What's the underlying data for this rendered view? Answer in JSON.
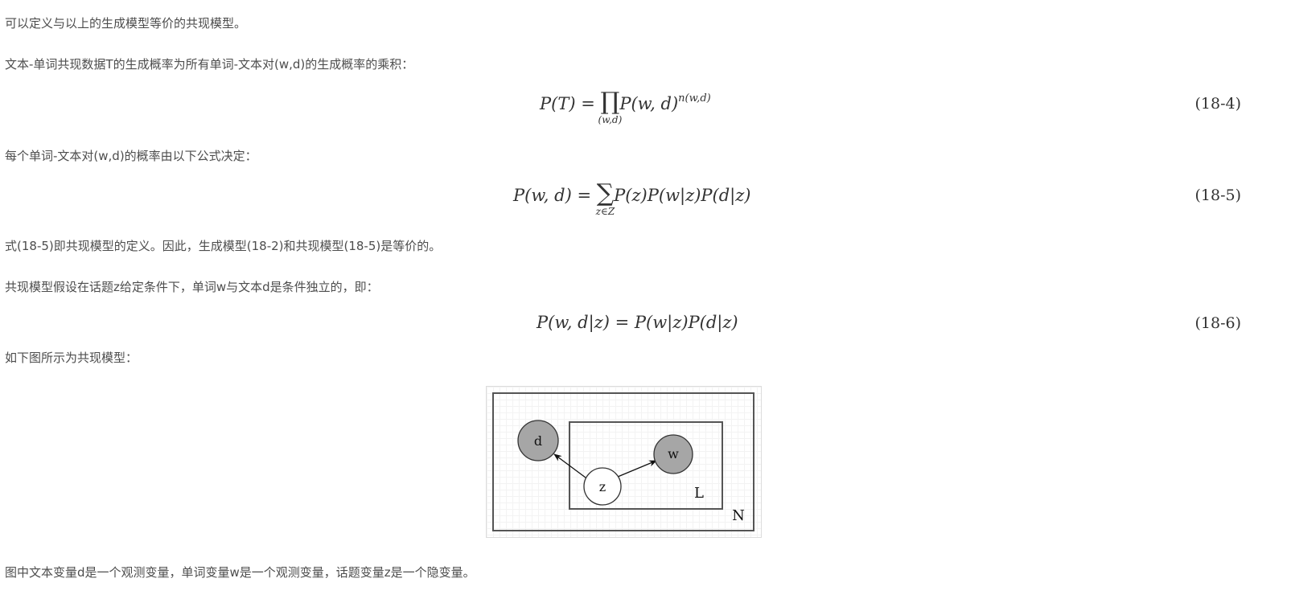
{
  "paragraphs": {
    "p1": "可以定义与以上的生成模型等价的共现模型。",
    "p2": "文本-单词共现数据T的生成概率为所有单词-文本对(w,d)的生成概率的乘积：",
    "p3": "每个单词-文本对(w,d)的概率由以下公式决定：",
    "p4": "式(18-5)即共现模型的定义。因此，生成模型(18-2)和共现模型(18-5)是等价的。",
    "p5": "共现模型假设在话题z给定条件下，单词w与文本d是条件独立的，即：",
    "p6": "如下图所示为共现模型：",
    "p7": "图中文本变量d是一个观测变量，单词变量w是一个观测变量，话题变量z是一个隐变量。"
  },
  "equations": {
    "eq4": {
      "lhs": "P(T) = ",
      "operator": "∏",
      "subscript": "(w,d)",
      "rhs": "P(w, d)",
      "exponent": "n(w,d)",
      "number": "(18-4)"
    },
    "eq5": {
      "lhs": "P(w, d) = ",
      "operator": "∑",
      "subscript": "z∈Z",
      "rhs": "P(z)P(w|z)P(d|z)",
      "number": "(18-5)"
    },
    "eq6": {
      "text": "P(w, d|z) = P(w|z)P(d|z)",
      "number": "(18-6)"
    }
  },
  "diagram": {
    "nodes": {
      "d": "d",
      "w": "w",
      "z": "z"
    },
    "plates": {
      "inner": "L",
      "outer": "N"
    },
    "colors": {
      "observed": "#a6a6a6",
      "latent": "#ffffff",
      "stroke": "#555555"
    }
  }
}
